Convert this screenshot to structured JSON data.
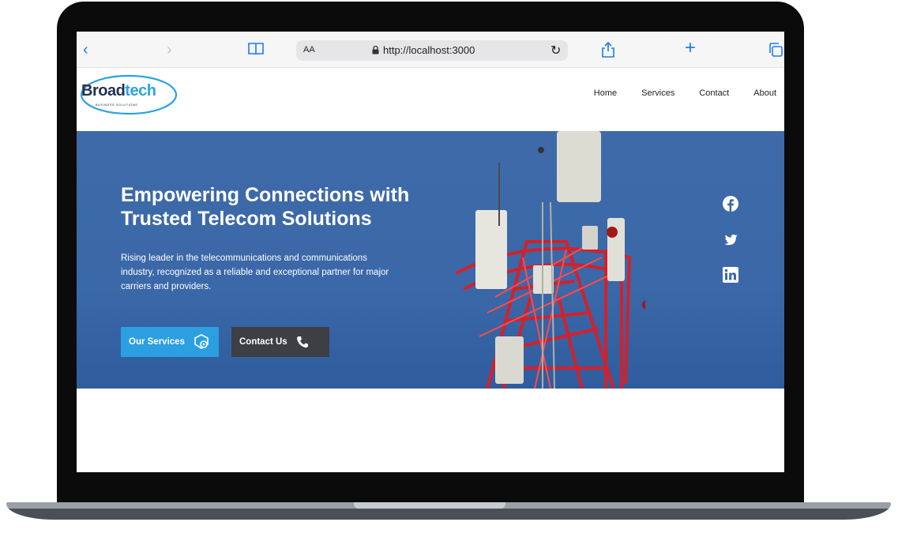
{
  "browser": {
    "reader_label": "AA",
    "url": "http://localhost:3000",
    "icons": [
      "back-icon",
      "forward-icon",
      "bookmarks-icon",
      "lock-icon",
      "reload-icon",
      "share-icon",
      "new-tab-icon",
      "tabs-icon"
    ]
  },
  "site": {
    "logo": {
      "part1": "Broad",
      "part2": "tech",
      "tagline": "BUSINESS SOLUTIONS"
    },
    "nav": [
      "Home",
      "Services",
      "Contact",
      "About"
    ]
  },
  "hero": {
    "title_line1": "Empowering Connections with",
    "title_line2": "Trusted Telecom Solutions",
    "subtitle": "Rising leader in the telecommunications and communications industry, recognized as a reliable and exceptional partner for major carriers and providers.",
    "buttons": {
      "services": "Our Services",
      "contact": "Contact Us"
    },
    "social": [
      "facebook-icon",
      "twitter-icon",
      "linkedin-icon"
    ]
  },
  "colors": {
    "accent": "#2b9fe0",
    "hero_bg": "#3d69a8",
    "dark_button": "#3d3f45",
    "logo_navy": "#22314f"
  }
}
